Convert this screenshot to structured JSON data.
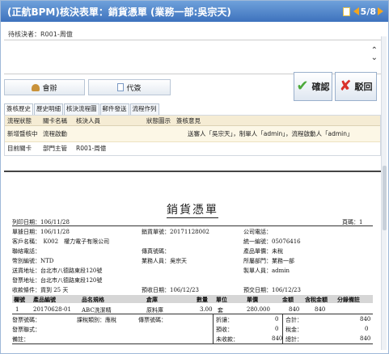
{
  "window": {
    "title": "(正航BPM)核決表單：銷貨憑單 (業務一部:吳宗天)",
    "pager": "5/8"
  },
  "approver_line": "待核決者：R001-周億",
  "buttons": {
    "countersign": "會辦",
    "delegate": "代簽",
    "confirm": "確認",
    "reject": "駁回"
  },
  "tabs": [
    "簽核歷史",
    "歷史明細",
    "核決流程圖",
    "郵件發送",
    "流程作列"
  ],
  "history": {
    "headers": [
      "流程狀態",
      "關卡名稱",
      "核決人員",
      "狀態圖示",
      "簽核意見"
    ],
    "rows": [
      {
        "status": "新增暨核中",
        "node": "流程啟動",
        "person": "",
        "opinion": "送審人「吳宗天」，制單人「admin」，流程啟動人「admin」"
      },
      {
        "status": "目前關卡",
        "node": "部門主管",
        "person": "R001-周億",
        "opinion": ""
      }
    ]
  },
  "form": {
    "title": "銷貨憑單",
    "print_date": "列印日期：106/11/28",
    "page": "頁碼：1",
    "doc_date": "單據日期：106/11/28",
    "sales_no": "銷貨單號：20171128002",
    "company_phone": "公司電話：",
    "customer": "客戶名稱：　K002　權力電子有限公司",
    "tax_id": "統一編號：05076416",
    "contact_phone": "聯絡電話：",
    "fax": "傳真號碼：",
    "prod_mgmt": "產品單價：未稅",
    "currency": "幣別編號：NTD",
    "salesperson": "業務人員：吳宗天",
    "dept": "所屬部門：業務一部",
    "ship_addr": "送貨地址：台北市八德路東段120號",
    "mail_addr": "發票地址：台北市八德路東段120號",
    "creator": "製單人員：admin",
    "pay_terms": "收款條件：貨到 25 天",
    "est_receipt": "預收日期：106/12/23",
    "est_ship": "預交日期：106/12/23",
    "grid_headers": [
      "欄號",
      "產品編號",
      "品名規格",
      "倉庫",
      "數量",
      "單位",
      "單價",
      "金額",
      "含稅金額",
      "分錄備註"
    ],
    "grid_row": [
      "1",
      "20170628-01",
      "ABC洗潔精",
      "原料庫",
      "3.00",
      "套",
      "280.000",
      "840",
      "840",
      ""
    ],
    "invoice_no": "發票號碼：",
    "detail_type": "課稅類別：應稅",
    "invoice_type": "發票聯式：",
    "fax_no": "傳票號碼：",
    "remark": "備註：",
    "discount_label": "折讓：",
    "discount_val": "0",
    "prepaid_label": "預收：",
    "prepaid_val": "0",
    "unpaid_label": "未收款：",
    "unpaid_val": "840",
    "subtotal_label": "合計：",
    "subtotal_val": "840",
    "tax_label": "稅金：",
    "tax_val": "0",
    "total_label": "總計：",
    "total_val": "840"
  },
  "colors": {
    "titlebar": "#3d72bd",
    "history_header": "#f5ecd4",
    "confirm_icon": "#4ca93a",
    "reject_icon": "#d9312a",
    "pager_arrows": "#f2a51e"
  }
}
